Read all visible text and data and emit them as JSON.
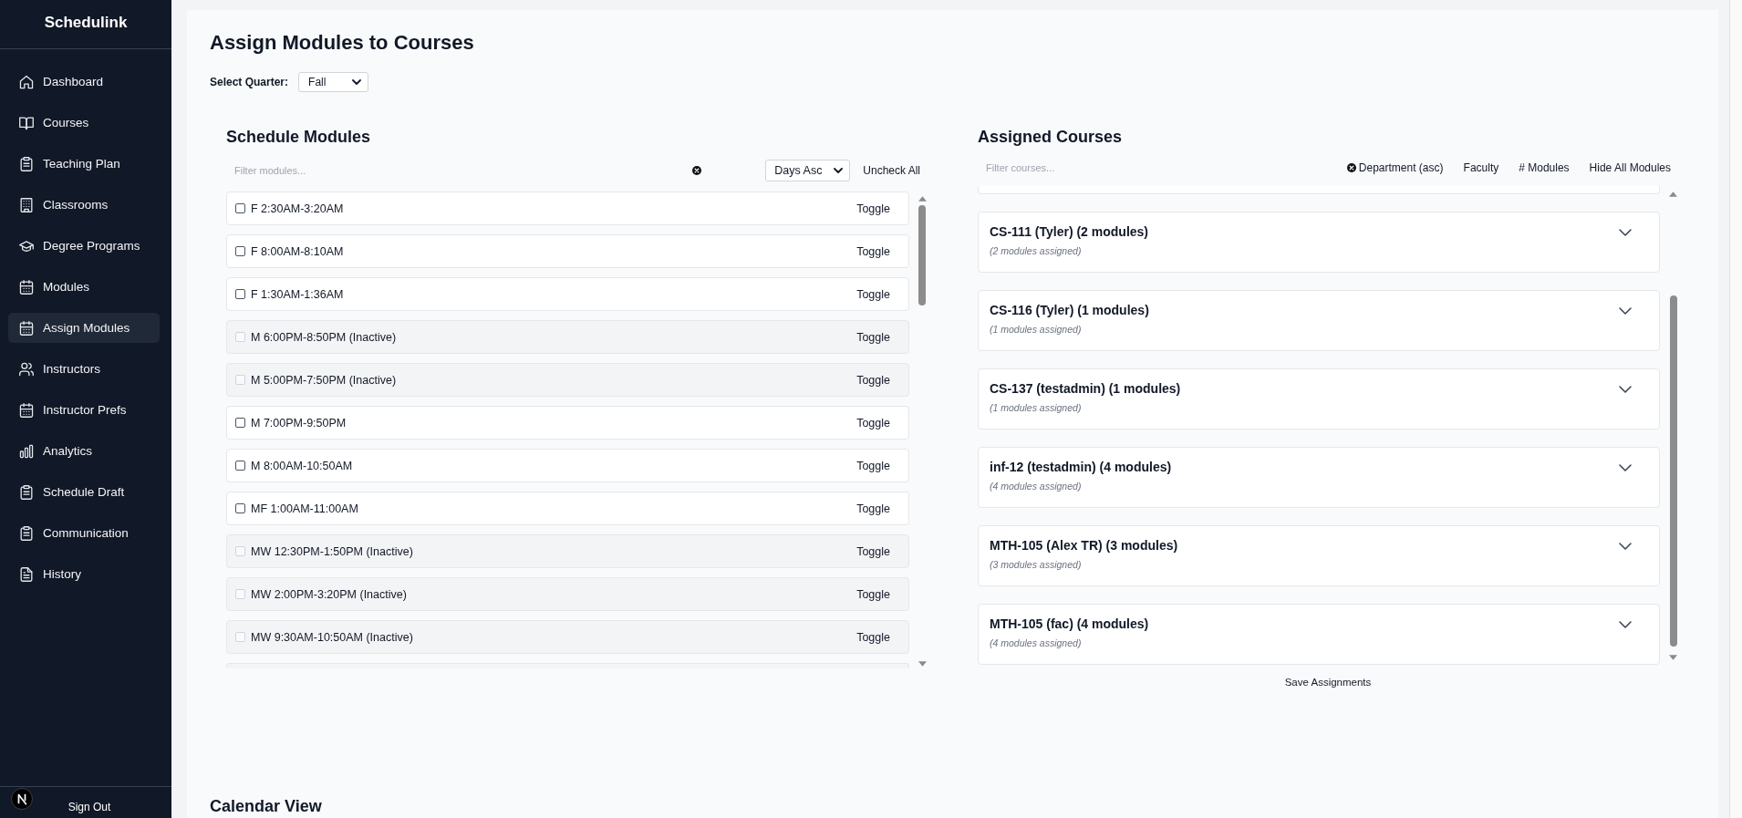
{
  "sidebar": {
    "brand": "Schedulink",
    "items": [
      {
        "label": "Dashboard",
        "selected": false
      },
      {
        "label": "Courses",
        "selected": false
      },
      {
        "label": "Teaching Plan",
        "selected": false
      },
      {
        "label": "Classrooms",
        "selected": false
      },
      {
        "label": "Degree Programs",
        "selected": false
      },
      {
        "label": "Modules",
        "selected": false
      },
      {
        "label": "Assign Modules",
        "selected": true
      },
      {
        "label": "Instructors",
        "selected": false
      },
      {
        "label": "Instructor Prefs",
        "selected": false
      },
      {
        "label": "Analytics",
        "selected": false
      },
      {
        "label": "Schedule Draft",
        "selected": false
      },
      {
        "label": "Communication",
        "selected": false
      },
      {
        "label": "History",
        "selected": false
      }
    ],
    "sign_out": "Sign Out"
  },
  "page": {
    "title": "Assign Modules to Courses",
    "quarter_label": "Select Quarter:",
    "quarter": "Fall"
  },
  "schedule_modules": {
    "heading": "Schedule Modules",
    "filter": {
      "placeholder": "Filter modules..."
    },
    "sort": "Days Asc",
    "uncheck_all": "Uncheck All",
    "modules": [
      {
        "label": "F 2:30AM-3:20AM",
        "checked": false,
        "inactive": false,
        "action": "Toggle"
      },
      {
        "label": "F 8:00AM-8:10AM",
        "checked": false,
        "inactive": false,
        "action": "Toggle"
      },
      {
        "label": "F 1:30AM-1:36AM",
        "checked": false,
        "inactive": false,
        "action": "Toggle"
      },
      {
        "label": "M 6:00PM-8:50PM (Inactive)",
        "checked": false,
        "inactive": true,
        "action": "Toggle"
      },
      {
        "label": "M 5:00PM-7:50PM (Inactive)",
        "checked": false,
        "inactive": true,
        "action": "Toggle"
      },
      {
        "label": "M 7:00PM-9:50PM",
        "checked": false,
        "inactive": false,
        "action": "Toggle"
      },
      {
        "label": "M 8:00AM-10:50AM",
        "checked": false,
        "inactive": false,
        "action": "Toggle"
      },
      {
        "label": "MF 1:00AM-11:00AM",
        "checked": false,
        "inactive": false,
        "action": "Toggle"
      },
      {
        "label": "MW 12:30PM-1:50PM (Inactive)",
        "checked": false,
        "inactive": true,
        "action": "Toggle"
      },
      {
        "label": "MW 2:00PM-3:20PM (Inactive)",
        "checked": false,
        "inactive": true,
        "action": "Toggle"
      },
      {
        "label": "MW 9:30AM-10:50AM (Inactive)",
        "checked": false,
        "inactive": true,
        "action": "Toggle"
      }
    ],
    "more_below": true
  },
  "assigned_courses": {
    "heading": "Assigned Courses",
    "filter": {
      "placeholder": "Filter courses..."
    },
    "sort_buttons": [
      "Department (asc)",
      "Faculty",
      "# Modules"
    ],
    "hide_all": "Hide All Modules",
    "more_above": true,
    "courses": [
      {
        "title": "CS-111 (Tyler) (2 modules)",
        "summary": "(2 modules assigned)",
        "expanded": false
      },
      {
        "title": "CS-116 (Tyler) (1 modules)",
        "summary": "(1 modules assigned)",
        "expanded": false
      },
      {
        "title": "CS-137 (testadmin) (1 modules)",
        "summary": "(1 modules assigned)",
        "expanded": false
      },
      {
        "title": "inf-12 (testadmin) (4 modules)",
        "summary": "(4 modules assigned)",
        "expanded": false
      },
      {
        "title": "MTH-105 (Alex TR) (3 modules)",
        "summary": "(3 modules assigned)",
        "expanded": false
      },
      {
        "title": "MTH-105 (fac) (4 modules)",
        "summary": "(4 modules assigned)",
        "expanded": false
      }
    ],
    "save": "Save Assignments"
  },
  "calendar": {
    "heading": "Calendar View"
  }
}
